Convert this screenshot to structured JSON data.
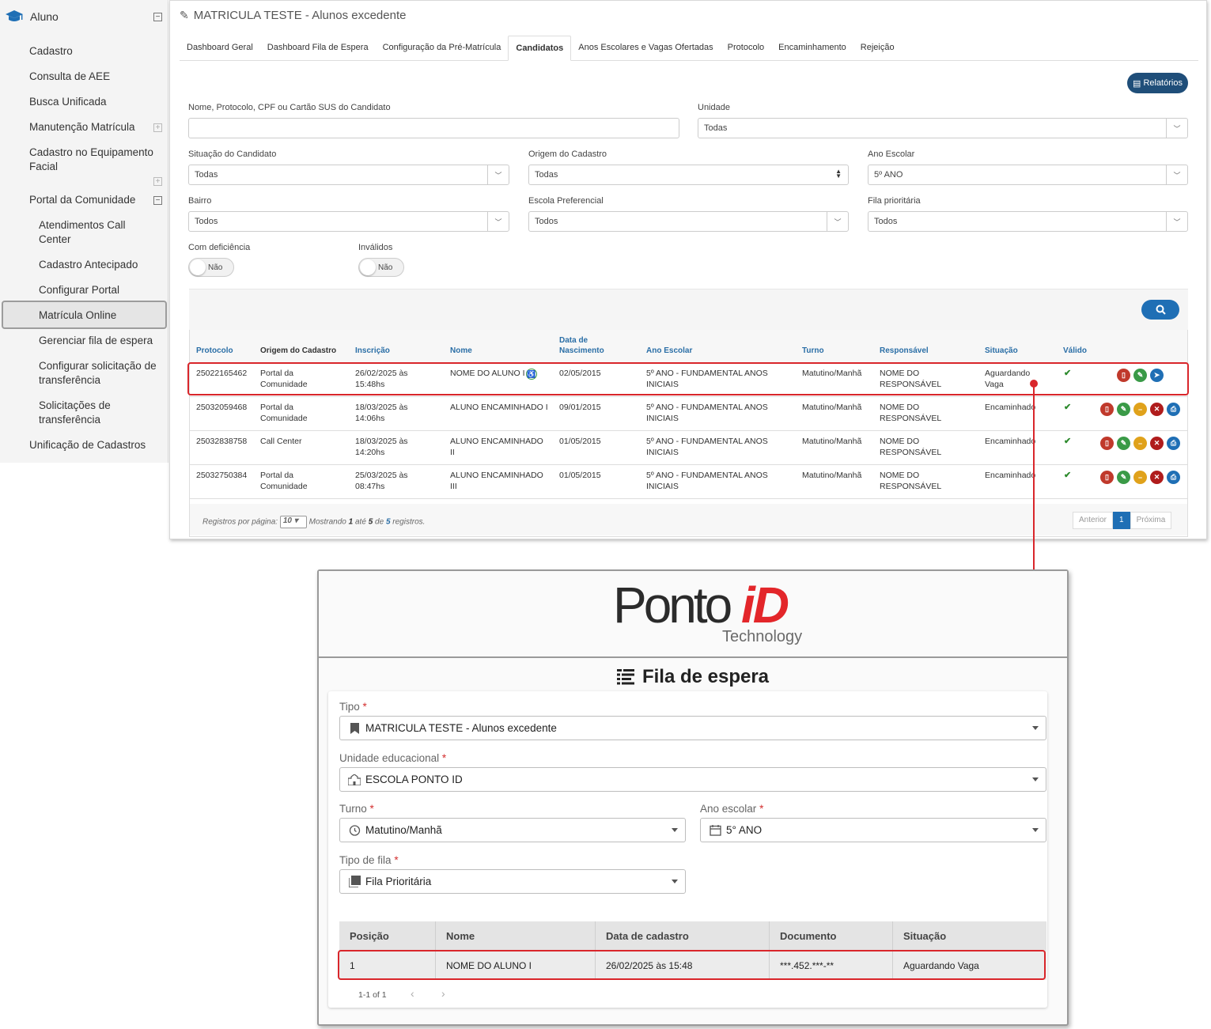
{
  "sidebar": {
    "section": "Aluno",
    "items": [
      {
        "label": "Cadastro"
      },
      {
        "label": "Consulta de AEE"
      },
      {
        "label": "Busca Unificada"
      },
      {
        "label": "Manutenção Matrícula"
      },
      {
        "label": "Cadastro no Equipamento Facial"
      },
      {
        "label": "Portal da Comunidade"
      },
      {
        "label": "Atendimentos Call Center"
      },
      {
        "label": "Cadastro Antecipado"
      },
      {
        "label": "Configurar Portal"
      },
      {
        "label": "Matrícula Online"
      },
      {
        "label": "Gerenciar fila de espera"
      },
      {
        "label": "Configurar solicitação de transferência"
      },
      {
        "label": "Solicitações de transferência"
      },
      {
        "label": "Unificação de Cadastros"
      }
    ]
  },
  "page": {
    "title": "MATRICULA TESTE - Alunos excedente",
    "tabs": [
      {
        "label": "Dashboard Geral"
      },
      {
        "label": "Dashboard Fila de Espera"
      },
      {
        "label": "Configuração da Pré-Matrícula"
      },
      {
        "label": "Candidatos"
      },
      {
        "label": "Anos Escolares e Vagas Ofertadas"
      },
      {
        "label": "Protocolo"
      },
      {
        "label": "Encaminhamento"
      },
      {
        "label": "Rejeição"
      }
    ],
    "reports_button": "Relatórios"
  },
  "filters": {
    "search_label": "Nome, Protocolo, CPF ou Cartão SUS do Candidato",
    "search_value": "",
    "unidade_label": "Unidade",
    "unidade_value": "Todas",
    "situacao_label": "Situação do Candidato",
    "situacao_value": "Todas",
    "origem_label": "Origem do Cadastro",
    "origem_value": "Todas",
    "ano_label": "Ano Escolar",
    "ano_value": "5º ANO",
    "bairro_label": "Bairro",
    "bairro_value": "Todos",
    "escola_label": "Escola Preferencial",
    "escola_value": "Todos",
    "fila_label": "Fila prioritária",
    "fila_value": "Todos",
    "deficiencia_label": "Com deficiência",
    "deficiencia_value": "Não",
    "invalidos_label": "Inválidos",
    "invalidos_value": "Não"
  },
  "table": {
    "headers": {
      "protocolo": "Protocolo",
      "origem": "Origem do Cadastro",
      "inscricao": "Inscrição",
      "nome": "Nome",
      "nascimento_1": "Data de",
      "nascimento_2": "Nascimento",
      "ano": "Ano Escolar",
      "turno": "Turno",
      "responsavel": "Responsável",
      "situacao": "Situação",
      "valido": "Válido"
    },
    "rows": [
      {
        "protocolo": "25022165462",
        "origem_1": "Portal da",
        "origem_2": "Comunidade",
        "inscricao_1": "26/02/2025 às",
        "inscricao_2": "15:48hs",
        "nome_1": "NOME DO ALUNO I",
        "nome_2": "",
        "nascimento": "02/05/2015",
        "ano_1": "5º ANO - FUNDAMENTAL ANOS",
        "ano_2": "INICIAIS",
        "turno": "Matutino/Manhã",
        "resp_1": "NOME DO",
        "resp_2": "RESPONSÁVEL",
        "sit_1": "Aguardando",
        "sit_2": "Vaga",
        "valido": "✔"
      },
      {
        "protocolo": "25032059468",
        "origem_1": "Portal da",
        "origem_2": "Comunidade",
        "inscricao_1": "18/03/2025 às",
        "inscricao_2": "14:06hs",
        "nome_1": "ALUNO ENCAMINHADO I",
        "nome_2": "",
        "nascimento": "09/01/2015",
        "ano_1": "5º ANO - FUNDAMENTAL ANOS",
        "ano_2": "INICIAIS",
        "turno": "Matutino/Manhã",
        "resp_1": "NOME DO",
        "resp_2": "RESPONSÁVEL",
        "sit_1": "Encaminhado",
        "sit_2": "",
        "valido": "✔"
      },
      {
        "protocolo": "25032838758",
        "origem_1": "Call Center",
        "origem_2": "",
        "inscricao_1": "18/03/2025 às",
        "inscricao_2": "14:20hs",
        "nome_1": "ALUNO ENCAMINHADO",
        "nome_2": "II",
        "nascimento": "01/05/2015",
        "ano_1": "5º ANO - FUNDAMENTAL ANOS",
        "ano_2": "INICIAIS",
        "turno": "Matutino/Manhã",
        "resp_1": "NOME DO",
        "resp_2": "RESPONSÁVEL",
        "sit_1": "Encaminhado",
        "sit_2": "",
        "valido": "✔"
      },
      {
        "protocolo": "25032750384",
        "origem_1": "Portal da",
        "origem_2": "Comunidade",
        "inscricao_1": "25/03/2025 às",
        "inscricao_2": "08:47hs",
        "nome_1": "ALUNO ENCAMINHADO",
        "nome_2": "III",
        "nascimento": "01/05/2015",
        "ano_1": "5º ANO - FUNDAMENTAL ANOS",
        "ano_2": "INICIAIS",
        "turno": "Matutino/Manhã",
        "resp_1": "NOME DO",
        "resp_2": "RESPONSÁVEL",
        "sit_1": "Encaminhado",
        "sit_2": "",
        "valido": "✔"
      }
    ],
    "footer": {
      "per_page_label": "Registros por página:",
      "per_page_value": "10",
      "showing": "Mostrando",
      "from": "1",
      "to_word": "até",
      "to": "5",
      "of_word": "de",
      "total": "5",
      "records_word": "registros."
    },
    "pager": {
      "prev": "Anterior",
      "current": "1",
      "next": "Próxima"
    }
  },
  "kiosk": {
    "logo_main": "Ponto",
    "logo_accent": "iD",
    "logo_sub": "Technology",
    "title": "Fila de espera",
    "tipo_label": "Tipo",
    "tipo_value": "MATRICULA TESTE - Alunos excedente",
    "unidade_label": "Unidade educacional",
    "unidade_value": "ESCOLA PONTO ID",
    "turno_label": "Turno",
    "turno_value": "Matutino/Manhã",
    "ano_label": "Ano escolar",
    "ano_value": "5° ANO",
    "tipo_fila_label": "Tipo de fila",
    "tipo_fila_value": "Fila Prioritária",
    "required_mark": "*",
    "table_headers": [
      "Posição",
      "Nome",
      "Data de cadastro",
      "Documento",
      "Situação"
    ],
    "table_row": [
      "1",
      "NOME DO ALUNO I",
      "26/02/2025 às 15:48",
      "***.452.***-**",
      "Aguardando Vaga"
    ],
    "pagination_text": "1-1 of 1"
  },
  "colors": {
    "accent_blue": "#1f4e79",
    "link_blue": "#2a6ea6",
    "highlight_red": "#d9262b",
    "valid_green": "#2d8a2d"
  }
}
